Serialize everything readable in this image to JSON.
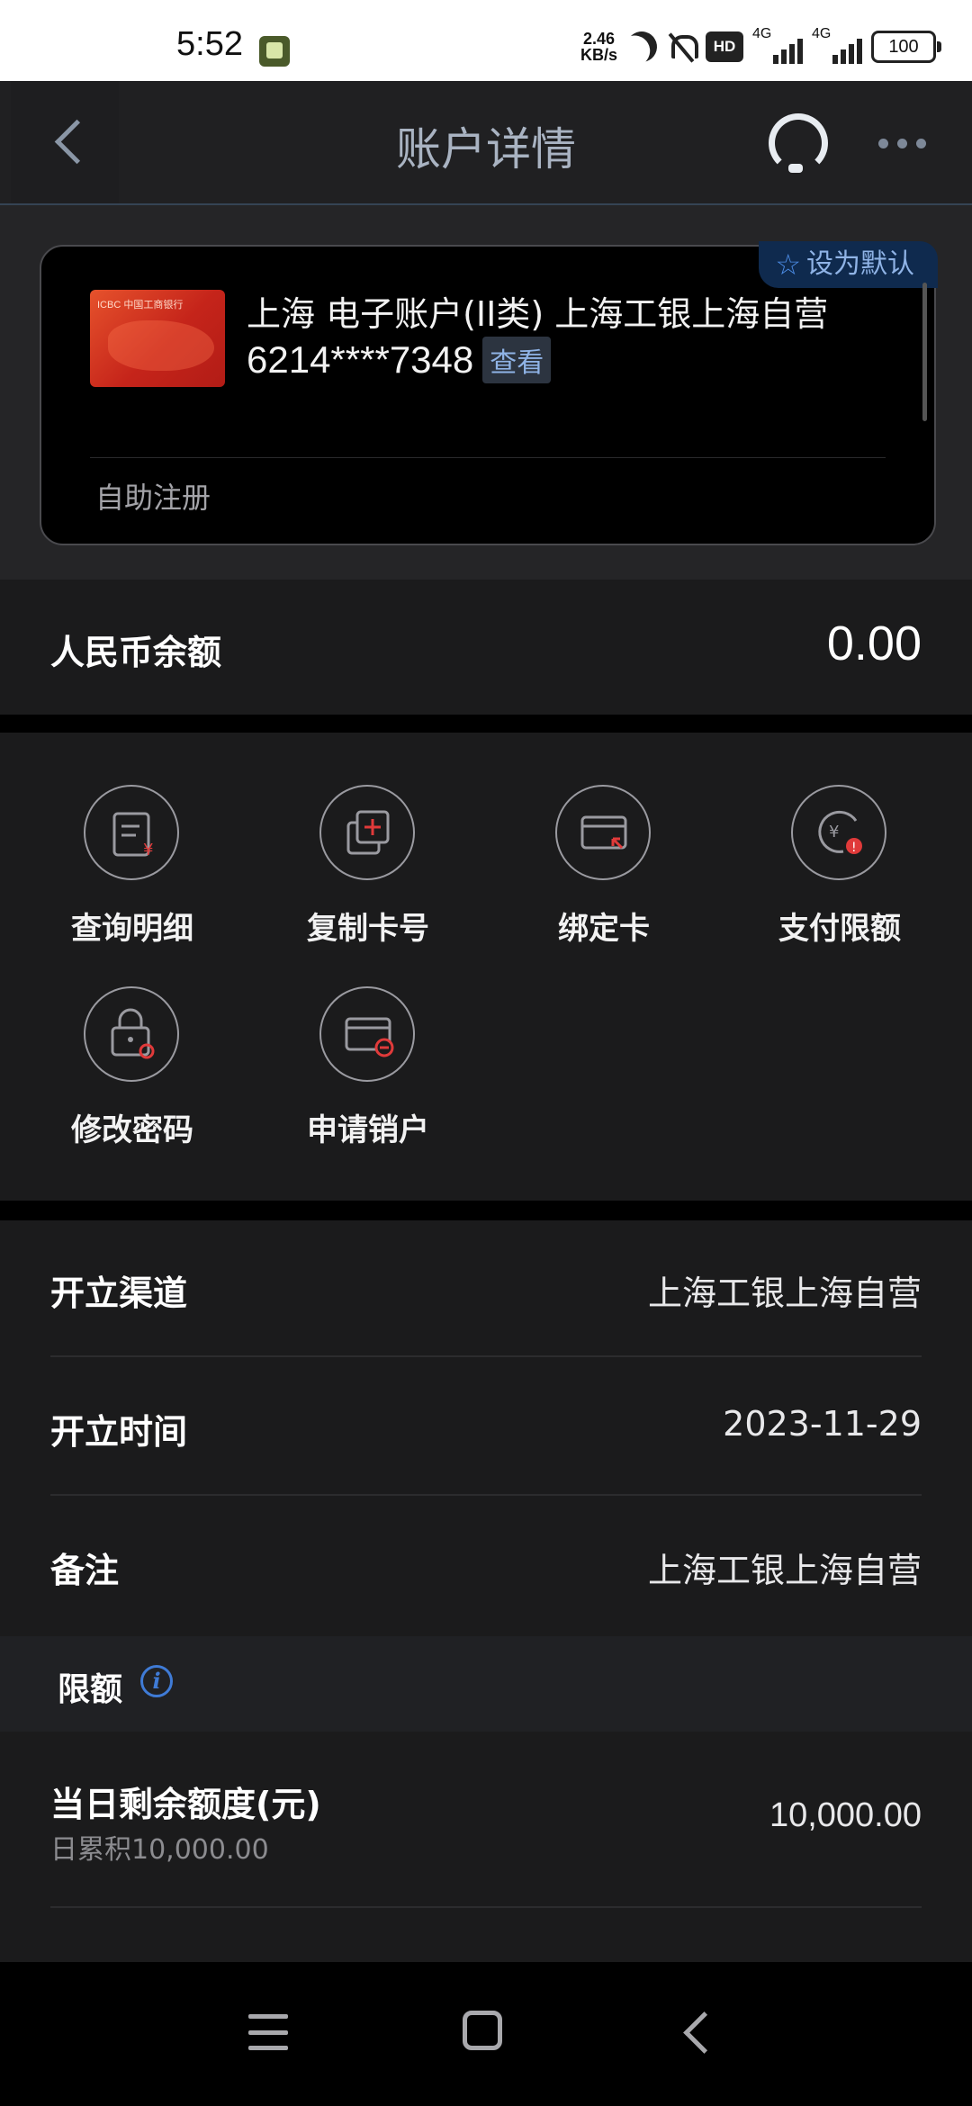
{
  "status_bar": {
    "time": "5:52",
    "net_speed_value": "2.46",
    "net_speed_unit": "KB/s",
    "hd_badge": "HD",
    "signal1_tag": "4G",
    "signal2_tag": "4G",
    "battery": "100"
  },
  "header": {
    "title": "账户详情"
  },
  "card": {
    "badge": "设为默认",
    "thumb_logo": "ICBC 中国工商银行",
    "name": "上海 电子账户(II类) 上海工银上海自营",
    "number": "6214****7348",
    "view_label": "查看",
    "register_label": "自助注册"
  },
  "balance": {
    "label": "人民币余额",
    "value": "0.00"
  },
  "actions": [
    {
      "label": "查询明细"
    },
    {
      "label": "复制卡号"
    },
    {
      "label": "绑定卡"
    },
    {
      "label": "支付限额"
    },
    {
      "label": "修改密码"
    },
    {
      "label": "申请销户"
    }
  ],
  "info": [
    {
      "key": "开立渠道",
      "value": "上海工银上海自营"
    },
    {
      "key": "开立时间",
      "value": "2023-11-29"
    },
    {
      "key": "备注",
      "value": "上海工银上海自营"
    }
  ],
  "limits": {
    "title": "限额",
    "daily_label": "当日剩余额度(元)",
    "daily_sub": "日累积10,000.00",
    "daily_value": "10,000.00"
  },
  "colors": {
    "accent_blue": "#3f7bd6",
    "badge_bg": "#0f2a4e",
    "card_red": "#c5241a",
    "icon_red": "#e03a3a"
  }
}
